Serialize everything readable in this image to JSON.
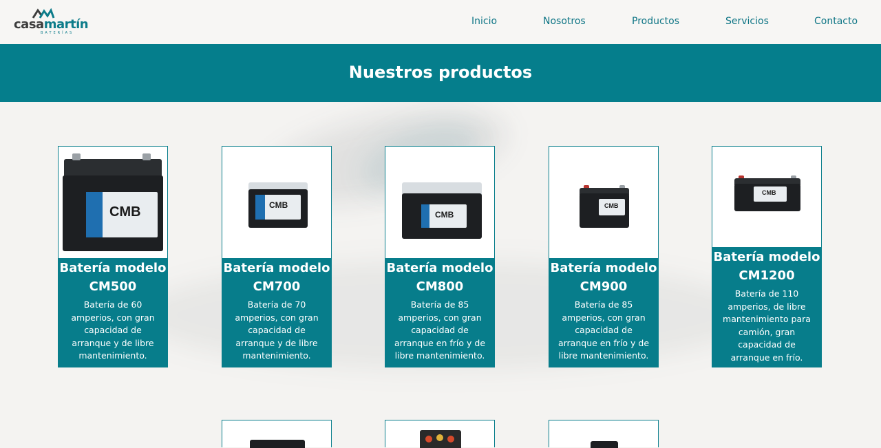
{
  "header": {
    "logo": {
      "brand_a": "casa",
      "brand_b": "martín",
      "subtitle": "BATERÍAS",
      "mark": "CM"
    },
    "nav": [
      {
        "label": "Inicio"
      },
      {
        "label": "Nosotros"
      },
      {
        "label": "Productos"
      },
      {
        "label": "Servicios"
      },
      {
        "label": "Contacto"
      }
    ]
  },
  "page_title": "Nuestros productos",
  "products": [
    {
      "name": "Batería modelo CM500",
      "description": "Batería de 60 amperios, con gran capacidad de arranque y de libre mantenimiento.",
      "image_brand": "CMB"
    },
    {
      "name": "Batería modelo CM700",
      "description": "Batería de 70 amperios, con gran capacidad de arranque y de libre mantenimiento.",
      "image_brand": "CMB"
    },
    {
      "name": "Batería modelo CM800",
      "description": "Batería de 85 amperios, con gran capacidad de arranque en frío y de libre mantenimiento.",
      "image_brand": "CMB"
    },
    {
      "name": "Batería modelo CM900",
      "description": "Batería de 85 amperios, con gran capacidad de arranque en frío y de libre mantenimiento.",
      "image_brand": "CMB"
    },
    {
      "name": "Batería modelo CM1200",
      "description": "Batería de 110 amperios, de libre mantenimiento para camión, gran capacidad de arranque en frío.",
      "image_brand": "CMB"
    }
  ],
  "colors": {
    "accent": "#077d8b",
    "title_bar": "#057e8c",
    "nav_text": "#0e7585"
  }
}
